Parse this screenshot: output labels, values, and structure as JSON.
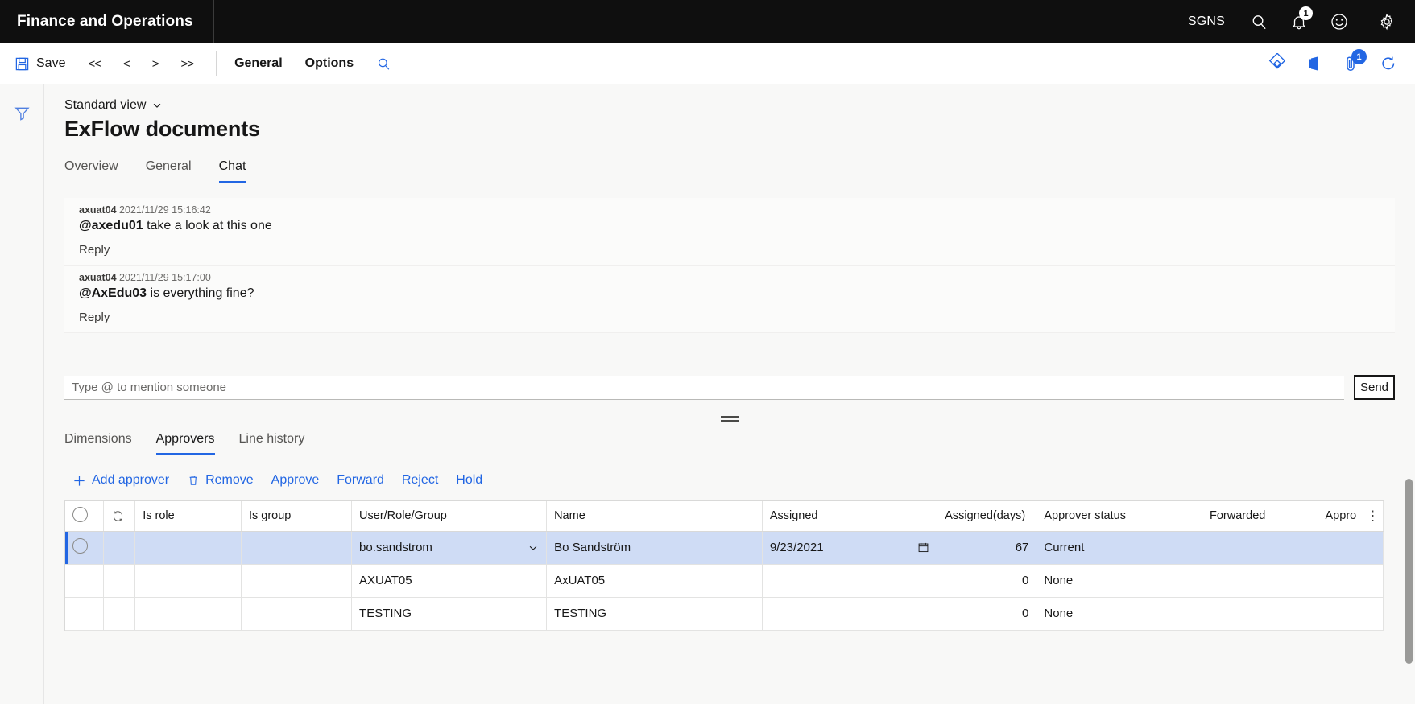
{
  "topbar": {
    "brand": "Finance and Operations",
    "company": "SGNS",
    "search_icon": "search-icon",
    "notifications_icon": "bell-icon",
    "notifications_badge": "1",
    "feedback_icon": "smiley-icon",
    "settings_icon": "gear-icon"
  },
  "commandbar": {
    "save_label": "Save",
    "save_icon": "save-icon",
    "nav_first": "<<",
    "nav_prev": "<",
    "nav_next": ">",
    "nav_last": ">>",
    "tab_general": "General",
    "tab_options": "Options",
    "search_icon": "search-icon",
    "right_icons": [
      {
        "name": "diamond-icon",
        "badge": ""
      },
      {
        "name": "office-app-icon",
        "badge": ""
      },
      {
        "name": "attachment-icon",
        "badge": "1"
      },
      {
        "name": "refresh-icon",
        "badge": ""
      }
    ]
  },
  "leftrail": {
    "filter_icon": "filter-icon"
  },
  "header": {
    "view_selector": "Standard view",
    "view_chevron": "chevron-down-icon",
    "page_title": "ExFlow documents"
  },
  "main_tabs": [
    {
      "label": "Overview",
      "active": false
    },
    {
      "label": "General",
      "active": false
    },
    {
      "label": "Chat",
      "active": true
    }
  ],
  "chat": {
    "messages": [
      {
        "author": "axuat04",
        "timestamp": "2021/11/29 15:16:42",
        "mention": "@axedu01",
        "text": " take a look at this one",
        "reply_label": "Reply"
      },
      {
        "author": "axuat04",
        "timestamp": "2021/11/29 15:17:00",
        "mention": "@AxEdu03",
        "text": " is everything fine?",
        "reply_label": "Reply"
      }
    ],
    "composer_placeholder": "Type @ to mention someone",
    "composer_value": "",
    "send_label": "Send"
  },
  "lower_tabs": [
    {
      "label": "Dimensions",
      "active": false
    },
    {
      "label": "Approvers",
      "active": true
    },
    {
      "label": "Line history",
      "active": false
    }
  ],
  "actionbar": [
    {
      "label": "Add approver",
      "icon": "plus-icon"
    },
    {
      "label": "Remove",
      "icon": "trash-icon"
    },
    {
      "label": "Approve",
      "icon": ""
    },
    {
      "label": "Forward",
      "icon": ""
    },
    {
      "label": "Reject",
      "icon": ""
    },
    {
      "label": "Hold",
      "icon": ""
    }
  ],
  "grid": {
    "columns": [
      {
        "label": "",
        "name": "select-all"
      },
      {
        "label": "",
        "name": "refresh"
      },
      {
        "label": "Is role",
        "name": "is-role"
      },
      {
        "label": "Is group",
        "name": "is-group"
      },
      {
        "label": "User/Role/Group",
        "name": "user-role-group"
      },
      {
        "label": "Name",
        "name": "name"
      },
      {
        "label": "Assigned",
        "name": "assigned"
      },
      {
        "label": "Assigned(days)",
        "name": "assigned-days"
      },
      {
        "label": "Approver status",
        "name": "approver-status"
      },
      {
        "label": "Forwarded",
        "name": "forwarded"
      },
      {
        "label": "Appro",
        "name": "approver-truncated"
      }
    ],
    "rows": [
      {
        "selected": true,
        "is_role": "",
        "is_group": "",
        "user": "bo.sandstrom",
        "name": "Bo Sandström",
        "assigned": "9/23/2021",
        "assigned_days": "67",
        "status": "Current",
        "forwarded": "",
        "appr": ""
      },
      {
        "selected": false,
        "is_role": "",
        "is_group": "",
        "user": "AXUAT05",
        "name": "AxUAT05",
        "assigned": "",
        "assigned_days": "0",
        "status": "None",
        "forwarded": "",
        "appr": ""
      },
      {
        "selected": false,
        "is_role": "",
        "is_group": "",
        "user": "TESTING",
        "name": "TESTING",
        "assigned": "",
        "assigned_days": "0",
        "status": "None",
        "forwarded": "",
        "appr": ""
      }
    ]
  },
  "colors": {
    "accent": "#2266e3",
    "topbar_bg": "#0f0f0f",
    "selected_row": "#cfdcf5",
    "page_bg": "#f8f8f7"
  }
}
